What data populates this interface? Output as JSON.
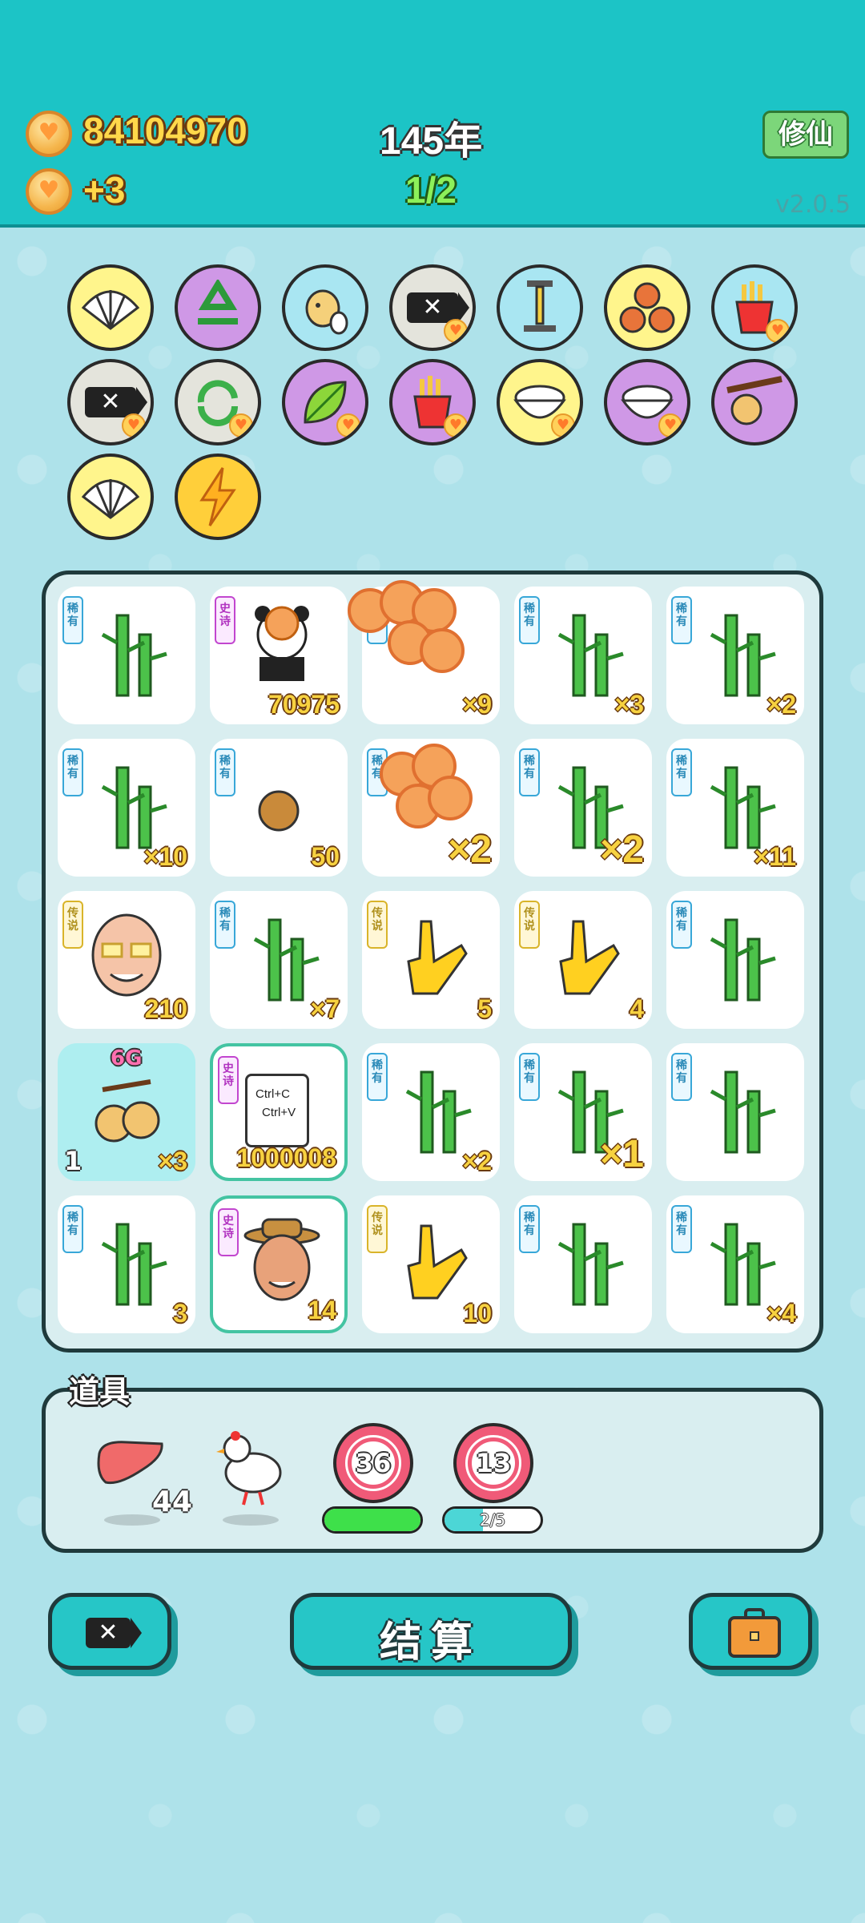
{
  "header": {
    "coins": "84104970",
    "coin_rate": "+3",
    "year": "145年",
    "progress": "1/2",
    "cultivate_label": "修仙",
    "version": "v2.0.5"
  },
  "skills": [
    {
      "name": "shell",
      "color": "yellow"
    },
    {
      "name": "recycle",
      "color": "purple"
    },
    {
      "name": "chick-egg",
      "color": "blue"
    },
    {
      "name": "delete-tag",
      "color": "gray"
    },
    {
      "name": "pump",
      "color": "blue"
    },
    {
      "name": "basketballs",
      "color": "yellow"
    },
    {
      "name": "fries",
      "color": "blue"
    },
    {
      "name": "delete-tag",
      "color": "gray"
    },
    {
      "name": "refresh",
      "color": "gray"
    },
    {
      "name": "leaf",
      "color": "purple"
    },
    {
      "name": "fries",
      "color": "purple"
    },
    {
      "name": "rice-bowl",
      "color": "yellow"
    },
    {
      "name": "rice-bowl",
      "color": "purple"
    },
    {
      "name": "fruit-branch",
      "color": "purple"
    },
    {
      "name": "shell",
      "color": "yellow"
    },
    {
      "name": "lightning",
      "color": "orange"
    }
  ],
  "tags": {
    "rare": "稀有",
    "epic": "史诗",
    "legend": "传说"
  },
  "grid": [
    [
      {
        "tag": "rare",
        "item": "bamboo",
        "count": ""
      },
      {
        "tag": "epic",
        "item": "panda",
        "count": "70975"
      },
      {
        "tag": "rare",
        "item": "bamboo",
        "count": "×9"
      },
      {
        "tag": "rare",
        "item": "bamboo",
        "count": "×3"
      },
      {
        "tag": "rare",
        "item": "bamboo",
        "count": "×2"
      }
    ],
    [
      {
        "tag": "rare",
        "item": "bamboo",
        "count": "×10"
      },
      {
        "tag": "rare",
        "item": "potato",
        "count": "50"
      },
      {
        "tag": "rare",
        "item": "bamboo",
        "count": "×2"
      },
      {
        "tag": "rare",
        "item": "bamboo",
        "count": "×2"
      },
      {
        "tag": "rare",
        "item": "bamboo",
        "count": "×11"
      }
    ],
    [
      {
        "tag": "legend",
        "item": "old-man",
        "count": "210"
      },
      {
        "tag": "rare",
        "item": "bamboo",
        "count": "×7"
      },
      {
        "tag": "legend",
        "item": "hand",
        "count": "5"
      },
      {
        "tag": "legend",
        "item": "hand",
        "count": "4"
      },
      {
        "tag": "rare",
        "item": "bamboo",
        "count": ""
      }
    ],
    [
      {
        "tag": "",
        "item": "fruit",
        "count": "×3",
        "left": "1",
        "top": "6G"
      },
      {
        "tag": "epic",
        "item": "ctrl-cv",
        "count": "1000008",
        "ctrl1": "Ctrl+C",
        "ctrl2": "Ctrl+V"
      },
      {
        "tag": "rare",
        "item": "bamboo",
        "count": "×2"
      },
      {
        "tag": "rare",
        "item": "bamboo",
        "count": "×1"
      },
      {
        "tag": "rare",
        "item": "bamboo",
        "count": ""
      }
    ],
    [
      {
        "tag": "rare",
        "item": "bamboo",
        "count": "3"
      },
      {
        "tag": "epic",
        "item": "farmer",
        "count": "14"
      },
      {
        "tag": "legend",
        "item": "hand",
        "count": "10"
      },
      {
        "tag": "rare",
        "item": "bamboo",
        "count": ""
      },
      {
        "tag": "rare",
        "item": "bamboo",
        "count": "×4"
      }
    ]
  ],
  "items": {
    "title": "道具",
    "liver_count": "44",
    "target1": "36",
    "target2": "13",
    "bar1_fill": 1.0,
    "bar2_fill": 0.4,
    "bar2_label": "2/5"
  },
  "buttons": {
    "settle": "结算"
  },
  "colors": {
    "header": "#1cc4c6",
    "accent": "#26c6c7",
    "bar_green": "#3ee04a",
    "bar_teal": "#4cd6d6"
  }
}
